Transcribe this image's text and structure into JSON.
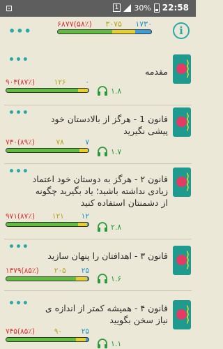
{
  "statusbar": {
    "time": "22:58",
    "battery": "30%",
    "sim": "1",
    "left_icon": "app-notification-icon"
  },
  "header": {
    "total": {
      "text": "۶۸۷۷(۵۸٪)",
      "value_yellow": "۳۰۷۵",
      "value_blue": "۱۷۳۰",
      "green_fraction": 0.58,
      "yellow_fraction": 0.25
    },
    "info_label": "i"
  },
  "lessons": [
    {
      "title": "مقدمه",
      "progress": "۹۰۳(۸۷٪)",
      "yellow": "۱۲۶",
      "blue": "۰",
      "green_fraction": 0.87,
      "yellow_fraction": 0.12,
      "count": "۱.۸"
    },
    {
      "title": "قانون 1 - هرگز از بالادستان خود پیشی نگیرید",
      "progress": "۷۳۰(۸۹٪)",
      "yellow": "۷۸",
      "blue": "۷",
      "green_fraction": 0.89,
      "yellow_fraction": 0.1,
      "count": "۱.۷"
    },
    {
      "title": "قانون ۲ - هرگز به دوستان خود اعتماد زیادی نداشته باشید؛ یاد بگیرید چگونه از دشمنتان استفاده کنید",
      "progress": "۹۷۱(۸۷٪)",
      "yellow": "۱۲۱",
      "blue": "۱۲",
      "green_fraction": 0.87,
      "yellow_fraction": 0.11,
      "count": "۲.۸"
    },
    {
      "title": "قانون ۳ - اهدافتان را پنهان سازید",
      "progress": "۱۳۷۹(۸۵٪)",
      "yellow": "۲۰۵",
      "blue": "۲۵",
      "green_fraction": 0.85,
      "yellow_fraction": 0.13,
      "count": "۱.۶"
    },
    {
      "title": "قانون ۴ - همیشه کمتر از اندازه ی نیاز سخن بگویید",
      "progress": "۷۴۵(۸۵٪)",
      "yellow": "۹۰",
      "blue": "۲۵",
      "green_fraction": 0.85,
      "yellow_fraction": 0.12,
      "count": "۱.۱"
    }
  ],
  "colors": {
    "accent": "#29a8a8",
    "green": "#5ebd3d",
    "yellow": "#e7cf2b",
    "blue": "#3a9fd9",
    "red_text": "#d93030",
    "background": "#ece8d8"
  },
  "icons": {
    "menu": "more-dots-icon",
    "info": "info-icon",
    "audio": "headphones-icon",
    "thumb": "megaphone-icon"
  }
}
